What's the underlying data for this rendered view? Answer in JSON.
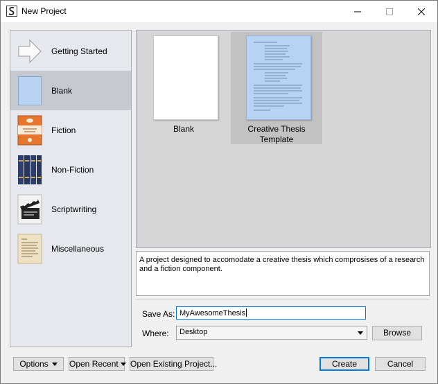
{
  "window": {
    "title": "New Project",
    "app_icon": "scrivener-icon"
  },
  "sidebar": {
    "items": [
      {
        "label": "Getting Started",
        "icon": "arrow-icon"
      },
      {
        "label": "Blank",
        "icon": "blank-page-icon",
        "selected": true
      },
      {
        "label": "Fiction",
        "icon": "novel-book-icon"
      },
      {
        "label": "Non-Fiction",
        "icon": "books-icon"
      },
      {
        "label": "Scriptwriting",
        "icon": "clapperboard-icon"
      },
      {
        "label": "Miscellaneous",
        "icon": "parchment-icon"
      }
    ]
  },
  "templates": [
    {
      "label": "Blank",
      "selected": false
    },
    {
      "label": "Creative Thesis Template",
      "selected": true
    }
  ],
  "description": "A project designed to accomodate a creative thesis which comprosises of a research and a fiction component.",
  "form": {
    "save_as_label": "Save As:",
    "save_as_value": "MyAwesomeThesis",
    "where_label": "Where:",
    "where_value": "Desktop",
    "browse_label": "Browse"
  },
  "footer": {
    "options_label": "Options",
    "open_recent_label": "Open Recent",
    "open_existing_label": "Open Existing Project...",
    "create_label": "Create",
    "cancel_label": "Cancel"
  },
  "colors": {
    "accent": "#0078d7",
    "selected_row": "#c6c9cf",
    "sidebar_bg": "#e6e8ee",
    "gallery_bg": "#d6d6d6"
  }
}
